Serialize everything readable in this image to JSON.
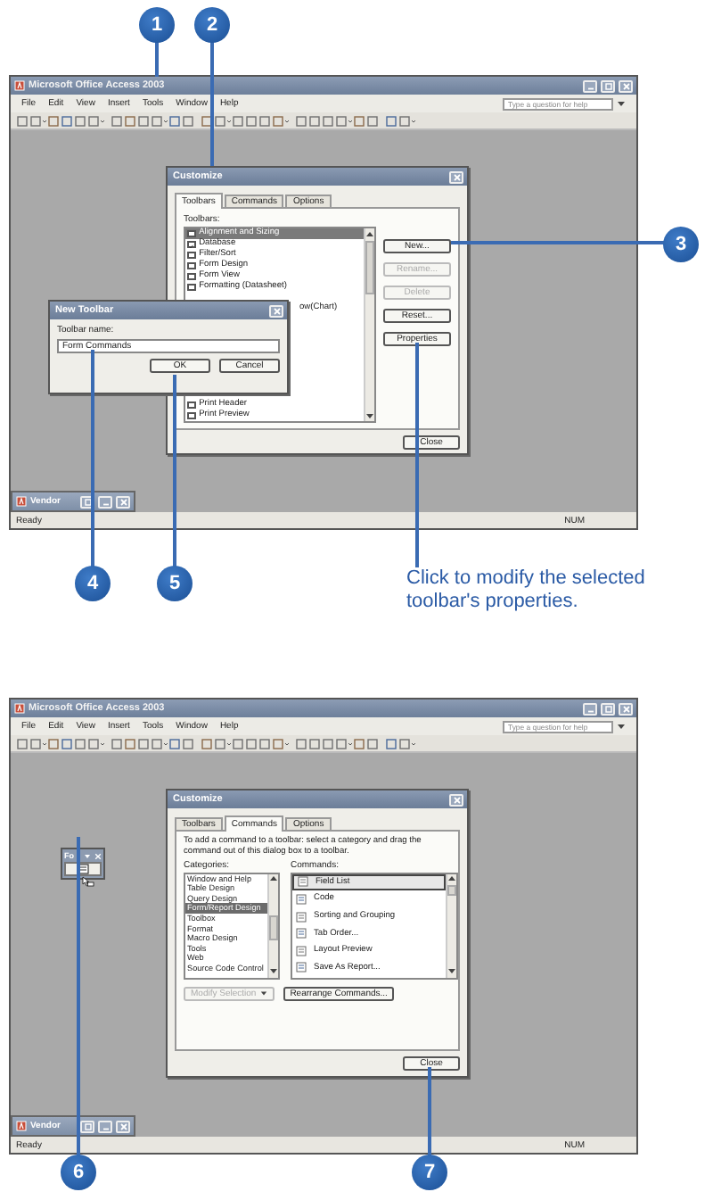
{
  "callouts": [
    {
      "number": "1"
    },
    {
      "number": "2"
    },
    {
      "number": "3"
    },
    {
      "number": "4"
    },
    {
      "number": "5"
    },
    {
      "number": "6"
    },
    {
      "number": "7"
    }
  ],
  "caption": "Click to modify the selected toolbar's properties.",
  "screens": [
    {
      "window": {
        "title": "Microsoft Office Access 2003"
      },
      "menu": [
        "File",
        "Edit",
        "View",
        "Insert",
        "Tools",
        "Window",
        "Help"
      ],
      "help_box": {
        "placeholder": "Type a question for help"
      },
      "customize": {
        "title": "Customize",
        "tabs": [
          {
            "label": "Toolbars",
            "selected": true
          },
          {
            "label": "Commands",
            "selected": false
          },
          {
            "label": "Options",
            "selected": false
          }
        ],
        "panel": {
          "kind": "toolbars",
          "list_label": "Toolbars:",
          "items": [
            {
              "kind": "row",
              "label": "Alignment and Sizing",
              "checked": false,
              "selected": true
            },
            {
              "kind": "row",
              "label": "Database",
              "checked": true,
              "selected": false
            },
            {
              "kind": "row",
              "label": "Filter/Sort",
              "checked": false,
              "selected": false
            },
            {
              "kind": "row",
              "label": "Form Design",
              "checked": false,
              "selected": false
            },
            {
              "kind": "row",
              "label": "Form View",
              "checked": false,
              "selected": false
            },
            {
              "kind": "row",
              "label": "Formatting (Datasheet)",
              "checked": false,
              "selected": false
            },
            {
              "kind": "clipped",
              "label": "ow(Chart)"
            },
            {
              "kind": "row",
              "label": "Print Header",
              "checked": false,
              "selected": false
            },
            {
              "kind": "row",
              "label": "Print Preview",
              "checked": false,
              "selected": false
            }
          ],
          "buttons": [
            {
              "label": "New...",
              "disabled": false
            },
            {
              "label": "Rename...",
              "disabled": true
            },
            {
              "label": "Delete",
              "disabled": true
            },
            {
              "label": "Reset...",
              "disabled": false
            },
            {
              "label": "Properties",
              "disabled": false
            }
          ]
        },
        "close": "Close"
      },
      "new_toolbar": {
        "title": "New Toolbar",
        "field_label": "Toolbar name:",
        "value": "Form Commands",
        "buttons": [
          "OK",
          "Cancel"
        ]
      },
      "minimized_window": {
        "title": "Vendor"
      },
      "status_bar": {
        "left": "Ready",
        "right": "NUM"
      }
    },
    {
      "window": {
        "title": "Microsoft Office Access 2003"
      },
      "menu": [
        "File",
        "Edit",
        "View",
        "Insert",
        "Tools",
        "Window",
        "Help"
      ],
      "help_box": {
        "placeholder": "Type a question for help"
      },
      "floating_toolbar": {
        "title": "Fo"
      },
      "customize": {
        "title": "Customize",
        "tabs": [
          {
            "label": "Toolbars",
            "selected": false
          },
          {
            "label": "Commands",
            "selected": true
          },
          {
            "label": "Options",
            "selected": false
          }
        ],
        "panel": {
          "kind": "commands",
          "description": "To add a command to a toolbar: select a category and drag the command out of this dialog box to a toolbar.",
          "categories_label": "Categories:",
          "categories": [
            {
              "label": "Window and Help",
              "selected": false
            },
            {
              "label": "Table Design",
              "selected": false
            },
            {
              "label": "Query Design",
              "selected": false
            },
            {
              "label": "Form/Report Design",
              "selected": true
            },
            {
              "label": "Toolbox",
              "selected": false
            },
            {
              "label": "Format",
              "selected": false
            },
            {
              "label": "Macro Design",
              "selected": false
            },
            {
              "label": "Tools",
              "selected": false
            },
            {
              "label": "Web",
              "selected": false
            },
            {
              "label": "Source Code Control",
              "selected": false
            }
          ],
          "commands_label": "Commands:",
          "commands": [
            {
              "label": "Field List",
              "selected": true
            },
            {
              "label": "Code",
              "selected": false
            },
            {
              "label": "Sorting and Grouping",
              "selected": false
            },
            {
              "label": "Tab Order...",
              "selected": false
            },
            {
              "label": "Layout Preview",
              "selected": false
            },
            {
              "label": "Save As Report...",
              "selected": false
            }
          ],
          "buttons": [
            {
              "kind": "dropdown",
              "label": "Modify Selection",
              "disabled": true
            },
            {
              "kind": "plain",
              "label": "Rearrange Commands...",
              "disabled": false
            }
          ]
        },
        "close": "Close"
      },
      "minimized_window": {
        "title": "Vendor"
      },
      "status_bar": {
        "left": "Ready",
        "right": "NUM"
      }
    }
  ]
}
